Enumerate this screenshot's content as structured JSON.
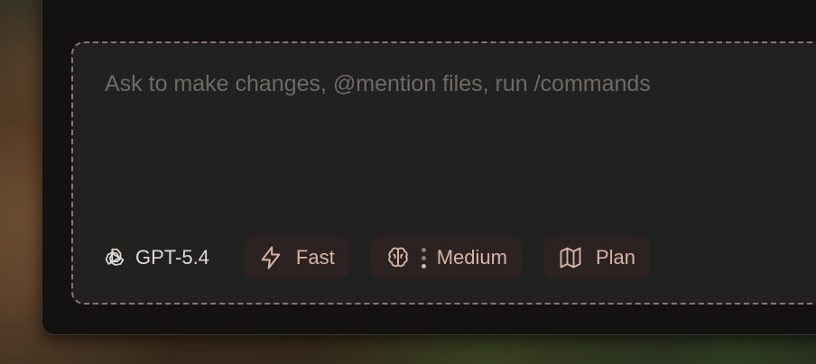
{
  "composer": {
    "placeholder": "Ask to make changes, @mention files, run /commands",
    "value": ""
  },
  "toolbar": {
    "model": {
      "label": "GPT-5.4",
      "icon": "openai-logo-icon"
    },
    "speed": {
      "label": "Fast",
      "icon": "lightning-icon"
    },
    "reasoning": {
      "label": "Medium",
      "icon": "brain-icon",
      "level_dots_active": 1,
      "level_dots_total": 3
    },
    "mode": {
      "label": "Plan",
      "icon": "map-icon"
    }
  },
  "colors": {
    "composer_bg": "#212120",
    "border_dashed": "#8c7577",
    "chip_bg": "#2b2221",
    "chip_text": "#d7b5a6",
    "placeholder": "#6e6a66"
  }
}
